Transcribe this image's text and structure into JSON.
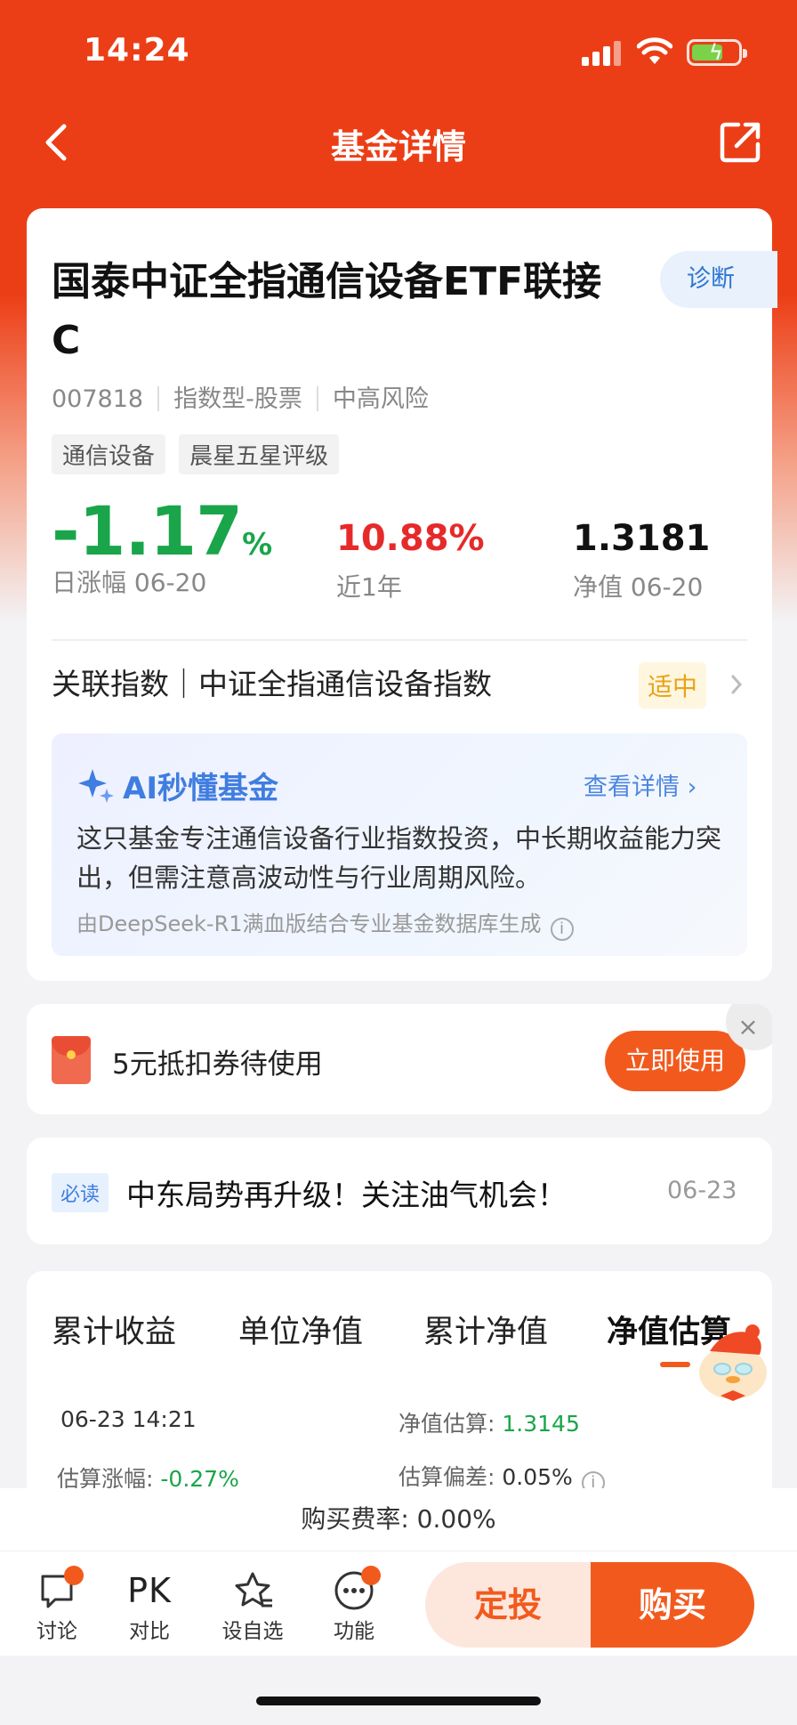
{
  "status_bar": {
    "time": "14:24"
  },
  "nav": {
    "title": "基金详情"
  },
  "fund": {
    "name": "国泰中证全指通信设备ETF联接C",
    "diagnose_label": "诊断",
    "code": "007818",
    "type": "指数型-股票",
    "risk": "中高风险",
    "tags": [
      "通信设备",
      "晨星五星评级"
    ],
    "daily_change": "-1.17",
    "daily_change_unit": "%",
    "daily_change_label": "日涨幅 06-20",
    "year_return": "10.88%",
    "year_return_label": "近1年",
    "nav_value": "1.3181",
    "nav_label": "净值 06-20",
    "index_text": "关联指数｜中证全指通信设备指数",
    "index_level": "适中"
  },
  "ai": {
    "title": "AI秒懂基金",
    "more_label": "查看详情",
    "summary": "这只基金专注通信设备行业指数投资，中长期收益能力突出，但需注意高波动性与行业周期风险。",
    "source": "由DeepSeek-R1满血版结合专业基金数据库生成"
  },
  "coupon": {
    "text": "5元抵扣券待使用",
    "button": "立即使用",
    "close": "×"
  },
  "news": {
    "badge": "必读",
    "title": "中东局势再升级！关注油气机会！",
    "date": "06-23"
  },
  "tabs": [
    "累计收益",
    "单位净值",
    "累计净值",
    "净值估算"
  ],
  "estimate": {
    "time": "06-23 14:21",
    "value_label": "净值估算:",
    "value": "1.3145",
    "change_label": "估算涨幅:",
    "change": "-0.27%",
    "deviation_label": "估算偏差:",
    "deviation": "0.05%"
  },
  "fee": {
    "text": "购买费率: 0.00%"
  },
  "bottom_bar": {
    "items": [
      {
        "label": "讨论",
        "icon": "chat-bubble-icon"
      },
      {
        "label": "对比",
        "icon": "PK"
      },
      {
        "label": "设自选",
        "icon": "star-icon"
      },
      {
        "label": "功能",
        "icon": "more-dots-icon"
      }
    ],
    "fixed_invest": "定投",
    "buy": "购买"
  },
  "colors": {
    "brand_red": "#ec3e16",
    "cta_orange": "#f25a1d",
    "down_green": "#1aa54a",
    "up_red": "#e62a2a",
    "ai_blue": "#3f7de0"
  }
}
